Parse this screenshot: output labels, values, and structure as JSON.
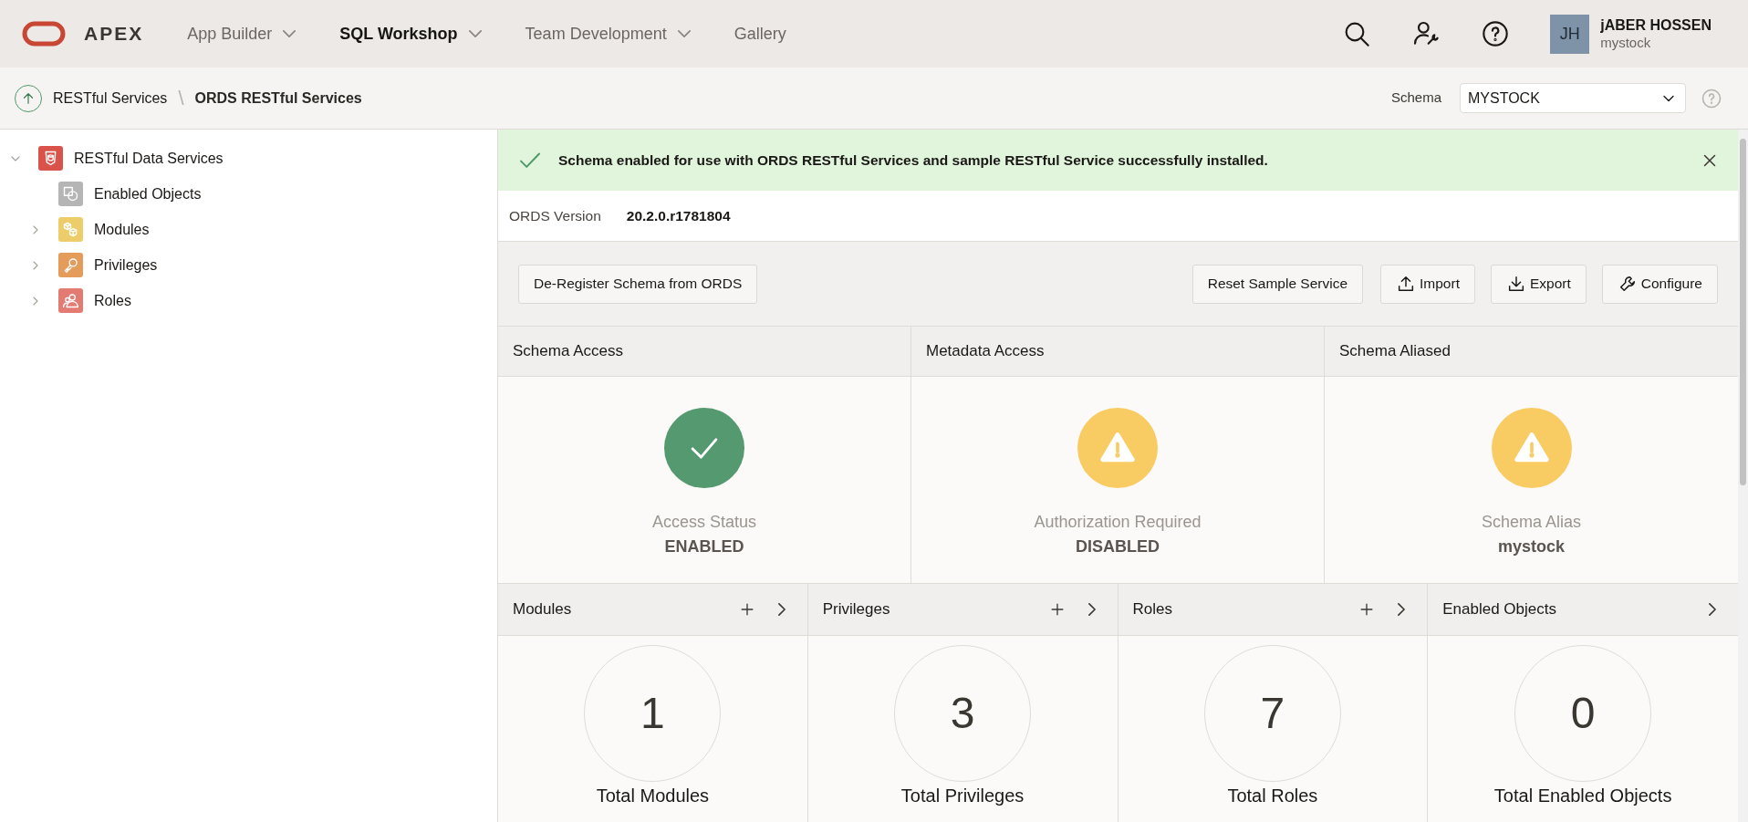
{
  "header": {
    "logo_text": "APEX",
    "nav": [
      {
        "label": "App Builder",
        "selected": false,
        "has_menu": true
      },
      {
        "label": "SQL Workshop",
        "selected": true,
        "has_menu": true
      },
      {
        "label": "Team Development",
        "selected": false,
        "has_menu": true
      },
      {
        "label": "Gallery",
        "selected": false,
        "has_menu": false
      }
    ],
    "user": {
      "initials": "JH",
      "name": "jABER HOSSEN",
      "workspace": "mystock"
    }
  },
  "breadcrumb": {
    "items": [
      "RESTful Services"
    ],
    "separator": "\\",
    "current": "ORDS RESTful Services",
    "schema_label": "Schema",
    "schema_value": "MYSTOCK"
  },
  "tree": [
    {
      "label": "RESTful Data Services",
      "kind": "root",
      "color": "#d9534a",
      "expandable": true,
      "expanded": true,
      "children": [
        {
          "label": "Enabled Objects",
          "kind": "objects",
          "color": "#b5b5b5",
          "expandable": false
        },
        {
          "label": "Modules",
          "kind": "modules",
          "color": "#eccd6a",
          "expandable": true,
          "expanded": false
        },
        {
          "label": "Privileges",
          "kind": "privileges",
          "color": "#e59b5a",
          "expandable": true,
          "expanded": false
        },
        {
          "label": "Roles",
          "kind": "roles",
          "color": "#e47b73",
          "expandable": true,
          "expanded": false
        }
      ]
    }
  ],
  "alert": {
    "message": "Schema enabled for use with ORDS RESTful Services and sample RESTful Service successfully installed."
  },
  "ords_version": {
    "label": "ORDS Version",
    "value": "20.2.0.r1781804"
  },
  "buttons": {
    "left": [
      {
        "label": "De-Register Schema from ORDS"
      }
    ],
    "right": [
      {
        "label": "Reset Sample Service",
        "kind": "plain"
      },
      {
        "label": "Import",
        "kind": "upload"
      },
      {
        "label": "Export",
        "kind": "download"
      },
      {
        "label": "Configure",
        "kind": "wrench"
      }
    ]
  },
  "status_cards": [
    {
      "title": "Schema Access",
      "kind": "ok",
      "caption": "Access Status",
      "value": "ENABLED"
    },
    {
      "title": "Metadata Access",
      "kind": "warning",
      "caption": "Authorization Required",
      "value": "DISABLED"
    },
    {
      "title": "Schema Aliased",
      "kind": "warning",
      "caption": "Schema Alias",
      "value": "mystock"
    }
  ],
  "count_cards": [
    {
      "title": "Modules",
      "can_add": true,
      "count": "1",
      "caption": "Total Modules"
    },
    {
      "title": "Privileges",
      "can_add": true,
      "count": "3",
      "caption": "Total Privileges"
    },
    {
      "title": "Roles",
      "can_add": true,
      "count": "7",
      "caption": "Total Roles"
    },
    {
      "title": "Enabled Objects",
      "can_add": false,
      "count": "0",
      "caption": "Total Enabled Objects"
    }
  ]
}
